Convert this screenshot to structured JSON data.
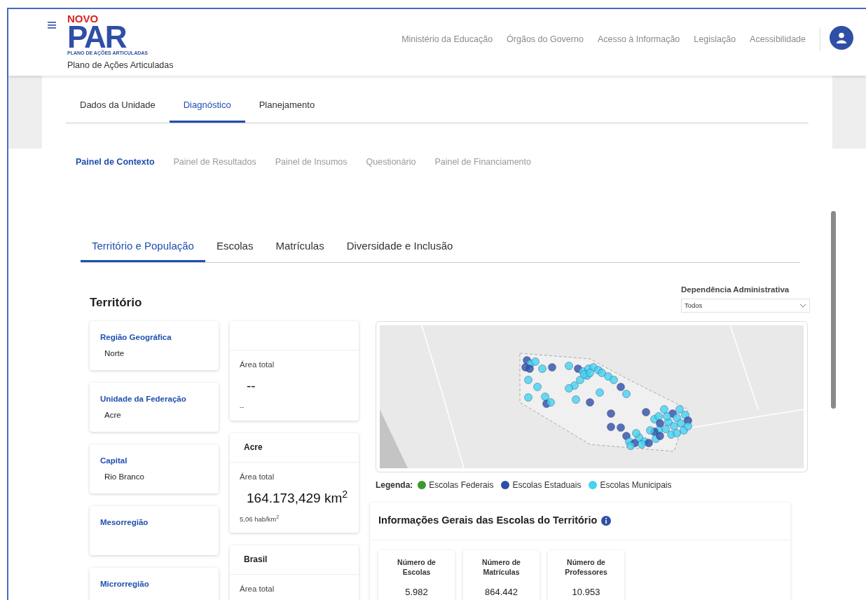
{
  "header": {
    "logo": {
      "top": "NOVO",
      "main": "PAR",
      "caption": "PLANO DE AÇÕES ARTICULADAS"
    },
    "subtitle": "Plano de Ações Articuladas",
    "nav_links": [
      "Ministério da Educação",
      "Órgãos do Governo",
      "Acesso à Informação",
      "Legislação",
      "Acessibilidade"
    ]
  },
  "main_tabs": [
    {
      "label": "Dados da Unidade",
      "selected": false
    },
    {
      "label": "Diagnóstico",
      "selected": true
    },
    {
      "label": "Planejamento",
      "selected": false
    }
  ],
  "sub_tabs": [
    {
      "label": "Painel de Contexto",
      "selected": true
    },
    {
      "label": "Painel de Resultados",
      "selected": false
    },
    {
      "label": "Painel de Insumos",
      "selected": false
    },
    {
      "label": "Questionário",
      "selected": false
    },
    {
      "label": "Painel de Financiamento",
      "selected": false
    }
  ],
  "section_tabs": [
    {
      "label": "Território e População",
      "selected": true
    },
    {
      "label": "Escolas",
      "selected": false
    },
    {
      "label": "Matrículas",
      "selected": false
    },
    {
      "label": "Diversidade e Inclusão",
      "selected": false
    }
  ],
  "section_title": "Território",
  "filter": {
    "label": "Dependência Administrativa",
    "value": "Todos"
  },
  "info_cards": [
    {
      "label": "Região Geográfica",
      "value": "Norte"
    },
    {
      "label": "Unidade da Federação",
      "value": "Acre"
    },
    {
      "label": "Capital",
      "value": "Rio Branco"
    },
    {
      "label": "Mesorregião"
    },
    {
      "label": "Microrregião"
    }
  ],
  "area_cards": [
    {
      "label": "Área total",
      "value": "--",
      "note": "--"
    },
    {
      "title": "Acre",
      "label": "Área total",
      "value": "164.173,429 km$^{2}$",
      "note": "5,06 hab/km$^{2}$"
    },
    {
      "title": "Brasil",
      "label": "Área total"
    }
  ],
  "legend": {
    "label": "Legenda:",
    "items": [
      {
        "label": "Escolas Federais",
        "color": "#3a9a2e"
      },
      {
        "label": "Escolas Estaduais",
        "color": "#2f4fa6"
      },
      {
        "label": "Escolas Municipais",
        "color": "#45d3ee"
      }
    ]
  },
  "schools_panel": {
    "title": "Informações Gerais das Escolas do Território",
    "stats": [
      {
        "label": "Número de Escolas",
        "value": "5.982"
      },
      {
        "label": "Número de Matrículas",
        "value": "864.442"
      },
      {
        "label": "Número de Professores",
        "value": "10.953"
      }
    ]
  }
}
